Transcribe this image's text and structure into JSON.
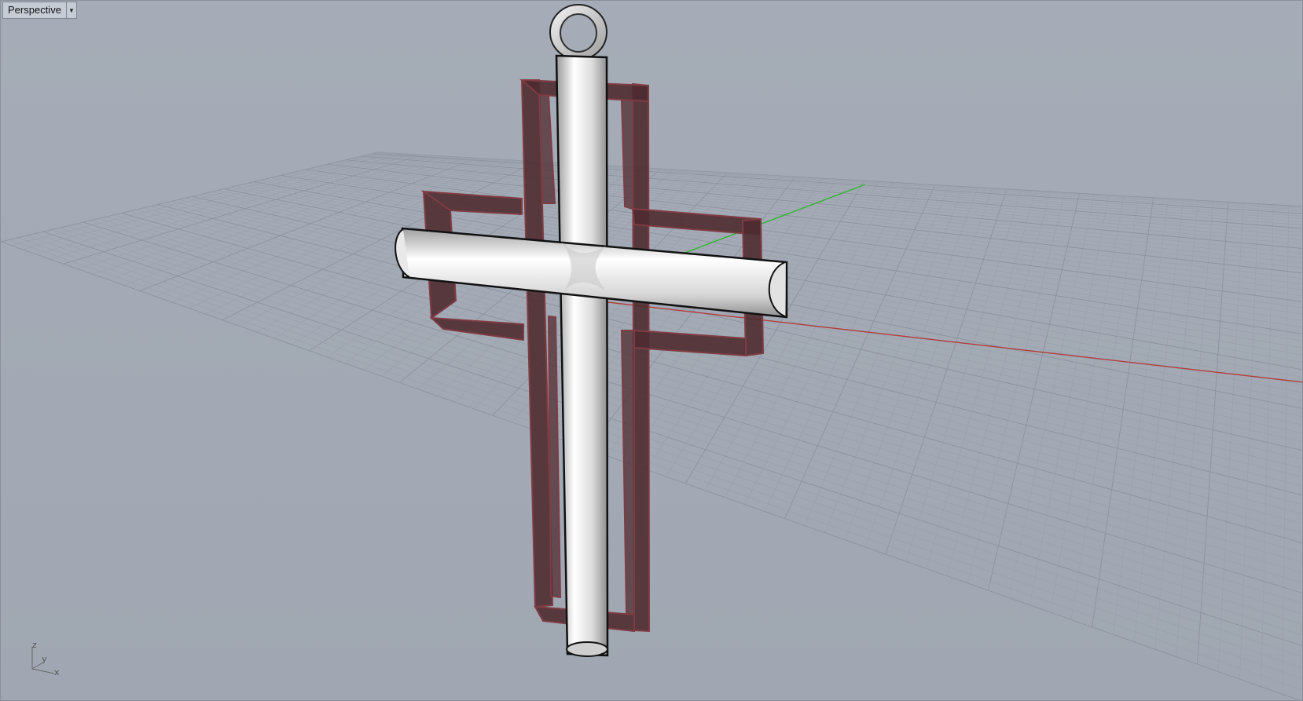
{
  "viewport": {
    "name": "Perspective",
    "menu_icon": "dropdown-arrow-icon",
    "colors": {
      "background": "#a3aab5",
      "grid_minor": "#98a0ab",
      "grid_major": "#8c939e",
      "x_axis": "#b23a3a",
      "y_axis": "#2fb52f",
      "frame_fill": "#4a2a2e",
      "frame_edge": "#7a3a40",
      "tube": "#e6e6e6"
    }
  },
  "axis_widget": {
    "z": "z",
    "y": "y",
    "x": "x"
  }
}
